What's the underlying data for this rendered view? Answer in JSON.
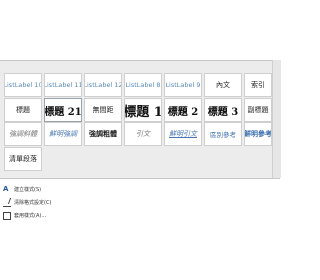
{
  "gallery": {
    "row1": [
      "ListLabel 10",
      "ListLabel 11",
      "ListLabel 12",
      "ListLabel 8",
      "ListLabel 9",
      "內文",
      "索引"
    ],
    "row2": [
      "標題",
      "標題 21",
      "無間距",
      "標題 1",
      "標題 2",
      "標題 3",
      "副標題"
    ],
    "row3": [
      "強調斜體",
      "鮮明強調",
      "強調粗體",
      "引文",
      "鮮明引文",
      "區別參考",
      "鮮明參考"
    ],
    "row4": [
      "清單段落"
    ]
  },
  "menu": {
    "create_style": "建立樣式(S)",
    "clear_formatting": "清除格式設定(C)",
    "apply_styles": "套用樣式(A)..."
  },
  "colors": {
    "gallery_bg": "#ececec",
    "accent_blue": "#4b78b5"
  }
}
